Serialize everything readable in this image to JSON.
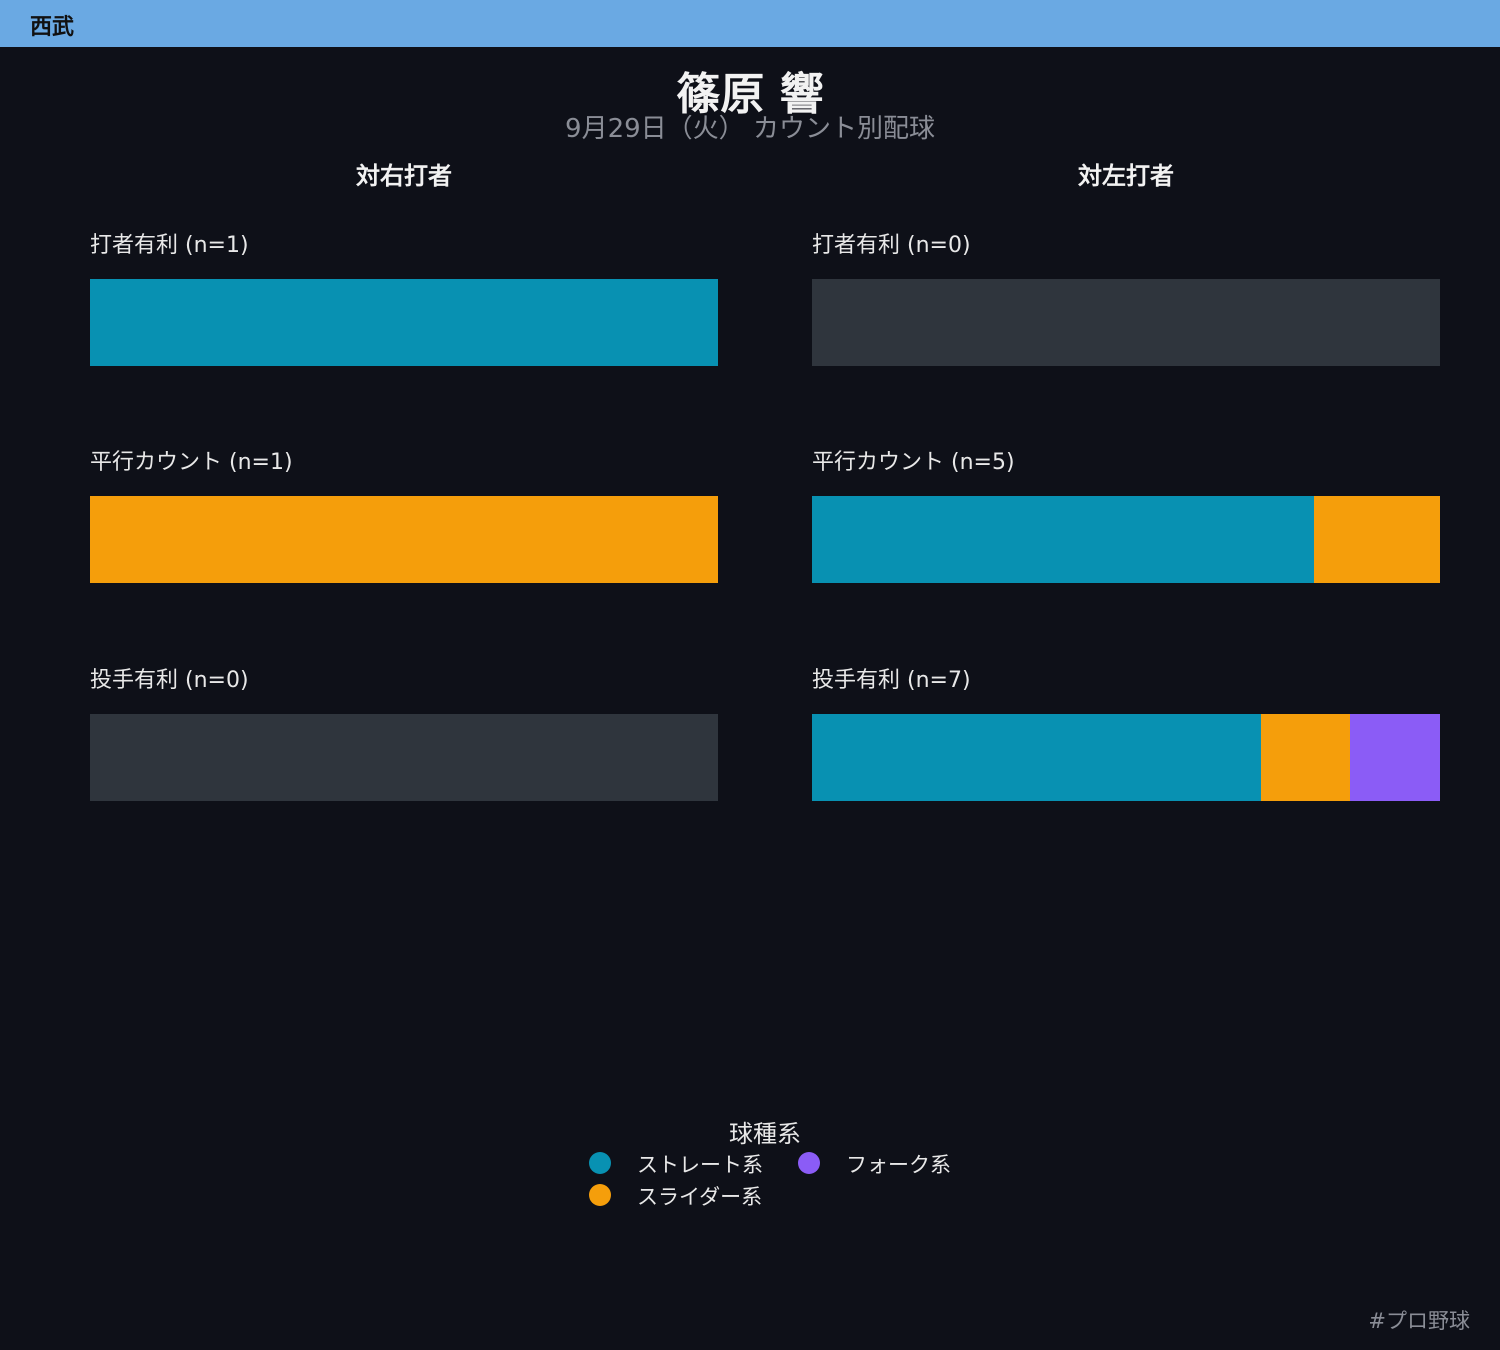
{
  "team": "西武",
  "chart_data": {
    "type": "bar",
    "orientation": "horizontal-stacked-100%",
    "title": "篠原 響",
    "subtitle": "9月29日（火） カウント別配球",
    "legend_title": "球種系",
    "series": [
      {
        "name": "ストレート系",
        "color": "#0891b2"
      },
      {
        "name": "スライダー系",
        "color": "#f59e0b"
      },
      {
        "name": "フォーク系",
        "color": "#8b5cf6"
      }
    ],
    "panels": [
      {
        "title": "対右打者",
        "groups": [
          {
            "label": "打者有利 (n=1)",
            "values": [
              1,
              0,
              0
            ]
          },
          {
            "label": "平行カウント (n=1)",
            "values": [
              0,
              1,
              0
            ]
          },
          {
            "label": "投手有利 (n=0)",
            "values": [
              0,
              0,
              0
            ]
          }
        ]
      },
      {
        "title": "対左打者",
        "groups": [
          {
            "label": "打者有利 (n=0)",
            "values": [
              0,
              0,
              0
            ]
          },
          {
            "label": "平行カウント (n=5)",
            "values": [
              4,
              1,
              0
            ]
          },
          {
            "label": "投手有利 (n=7)",
            "values": [
              5,
              1,
              1
            ]
          }
        ]
      }
    ]
  },
  "footer": {
    "hashtag": "#プロ野球"
  }
}
